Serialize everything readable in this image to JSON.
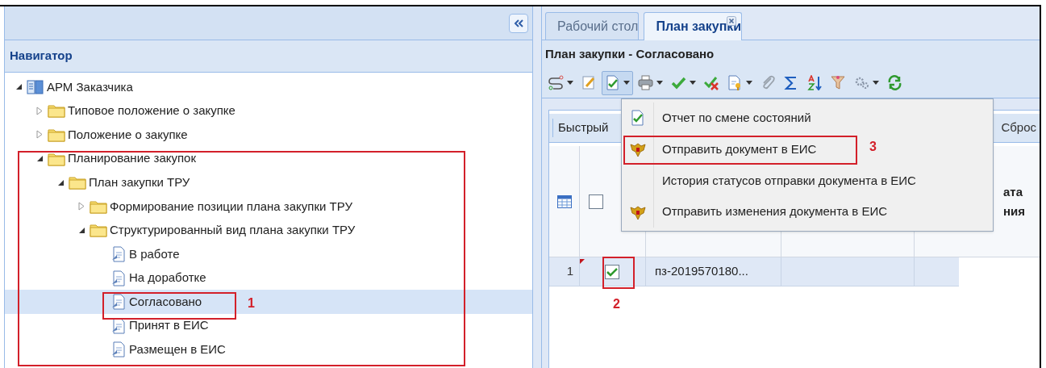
{
  "navigator": {
    "title": "Навигатор",
    "tree": [
      {
        "label": "АРМ Заказчика",
        "kind": "root",
        "expanded": true,
        "selected": false,
        "children": [
          {
            "label": "Типовое положение о закупке",
            "kind": "folder",
            "expanded": false,
            "selected": false
          },
          {
            "label": "Положение о закупке",
            "kind": "folder",
            "expanded": false,
            "selected": false
          },
          {
            "label": "Планирование закупок",
            "kind": "folder",
            "expanded": true,
            "selected": false,
            "children": [
              {
                "label": "План закупки ТРУ",
                "kind": "folder",
                "expanded": true,
                "selected": false,
                "children": [
                  {
                    "label": "Формирование позиции плана закупки ТРУ",
                    "kind": "folder",
                    "expanded": false,
                    "selected": false
                  },
                  {
                    "label": "Структурированный вид плана закупки ТРУ",
                    "kind": "folder",
                    "expanded": true,
                    "selected": false,
                    "children": [
                      {
                        "label": "В работе",
                        "kind": "doc",
                        "selected": false
                      },
                      {
                        "label": "На доработке",
                        "kind": "doc",
                        "selected": false
                      },
                      {
                        "label": "Согласовано",
                        "kind": "doc",
                        "selected": true
                      },
                      {
                        "label": "Принят в ЕИС",
                        "kind": "doc",
                        "selected": false
                      },
                      {
                        "label": "Размещен в ЕИС",
                        "kind": "doc",
                        "selected": false
                      }
                    ]
                  }
                ]
              }
            ]
          }
        ]
      }
    ]
  },
  "tabs": [
    {
      "label": "Рабочий стол",
      "selected": false,
      "closable": false
    },
    {
      "label": "План закупки",
      "selected": true,
      "closable": true
    }
  ],
  "panel_title": "План закупки - Согласовано",
  "toolbar": [
    {
      "kind": "route",
      "dropdown": true,
      "pressed": false
    },
    {
      "kind": "edit",
      "dropdown": false,
      "pressed": false
    },
    {
      "kind": "check-doc",
      "dropdown": true,
      "pressed": true
    },
    {
      "kind": "print",
      "dropdown": true,
      "pressed": false
    },
    {
      "kind": "check",
      "dropdown": true,
      "pressed": false
    },
    {
      "kind": "check-cross",
      "dropdown": false,
      "pressed": false
    },
    {
      "kind": "doc-key",
      "dropdown": true,
      "pressed": false
    },
    {
      "kind": "clip",
      "dropdown": false,
      "pressed": false
    },
    {
      "kind": "sigma",
      "dropdown": false,
      "pressed": false
    },
    {
      "kind": "sort",
      "dropdown": false,
      "pressed": false
    },
    {
      "kind": "filter",
      "dropdown": false,
      "pressed": false
    },
    {
      "kind": "gears",
      "dropdown": true,
      "pressed": false
    },
    {
      "kind": "refresh",
      "dropdown": false,
      "pressed": false
    }
  ],
  "filter_bar": {
    "left": "Быстрый",
    "right": "Сброс"
  },
  "grid": {
    "header_checked": false,
    "column_5": "ата\nния",
    "rows": [
      {
        "number": "1",
        "flagged": true,
        "checked": true,
        "column_3": "пз-2019570180..."
      }
    ]
  },
  "menu": [
    {
      "label": "Отчет по смене состояний",
      "kind": "report"
    },
    {
      "label": "Отправить документ в ЕИС",
      "kind": "send"
    },
    {
      "label": "История статусов отправки документа в ЕИС",
      "kind": "history"
    },
    {
      "label": "Отправить изменения документа в ЕИС",
      "kind": "send"
    }
  ],
  "annotations": [
    {
      "label": "1"
    },
    {
      "label": "2"
    },
    {
      "label": "3"
    }
  ]
}
